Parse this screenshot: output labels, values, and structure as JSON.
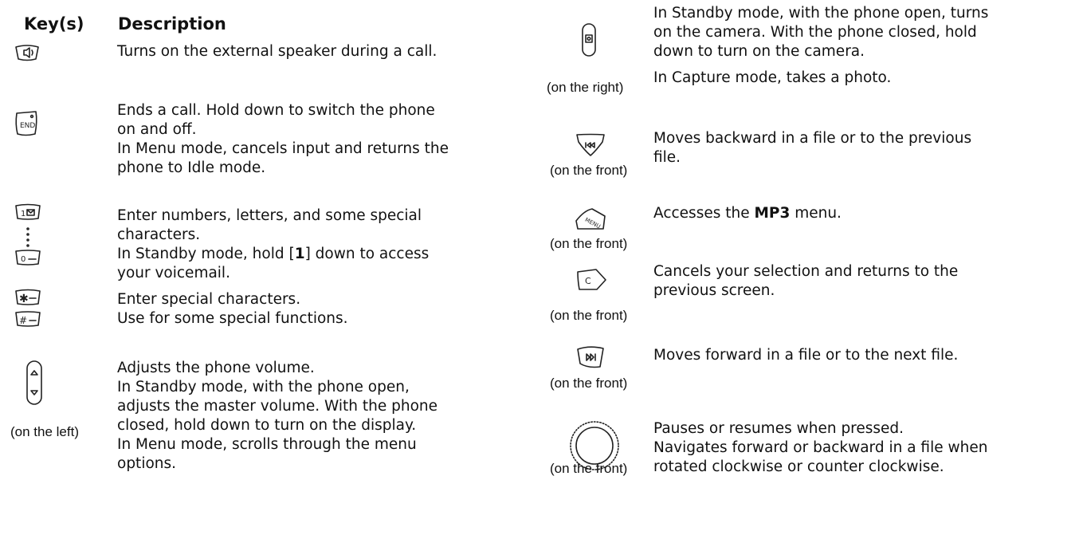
{
  "header": {
    "keys": "Key(s)",
    "description": "Description"
  },
  "left": {
    "speaker": {
      "lines": [
        "Turns on the external speaker during a call."
      ]
    },
    "end": {
      "lines": [
        "Ends a call. Hold down to switch the phone",
        "on and off.",
        "In Menu mode, cancels input and returns the",
        "phone to Idle mode."
      ]
    },
    "numbers": {
      "lines": [
        "Enter numbers, letters, and some special",
        "characters."
      ],
      "l3_pre": "In Standby mode, hold [",
      "l3_bold": "1",
      "l3_post": "] down to access",
      "l4": "your voicemail."
    },
    "special": {
      "lines": [
        "Enter special characters.",
        "Use for some special functions."
      ]
    },
    "volume": {
      "caption": "(on the left)",
      "lines": [
        "Adjusts the phone volume.",
        "In Standby mode, with the phone open,",
        "adjusts the master volume. With the phone",
        "closed, hold down to turn on the display.",
        "In Menu mode, scrolls through the menu",
        "options."
      ]
    }
  },
  "right": {
    "camera": {
      "caption": "(on the right)",
      "lines": [
        "In Standby mode, with the phone open, turns",
        "on the camera. With the phone closed, hold",
        "down to turn on the camera.",
        "In Capture mode, takes a photo."
      ]
    },
    "prev": {
      "caption": "(on the front)",
      "lines": [
        "Moves backward in a file or to the previous",
        "file."
      ]
    },
    "menu": {
      "caption": "(on the front)",
      "pre": "Accesses the ",
      "bold": "MP3",
      "post": " menu."
    },
    "cancel": {
      "caption": "(on the front)",
      "lines": [
        "Cancels your selection and returns to the",
        "previous screen."
      ]
    },
    "next": {
      "caption": "(on the front)",
      "lines": [
        "Moves forward in a file or to the next file."
      ]
    },
    "wheel": {
      "caption": "(on the front)",
      "lines": [
        "Pauses or resumes when pressed.",
        "Navigates forward or backward in a file when",
        "rotated clockwise or counter clockwise."
      ]
    }
  }
}
